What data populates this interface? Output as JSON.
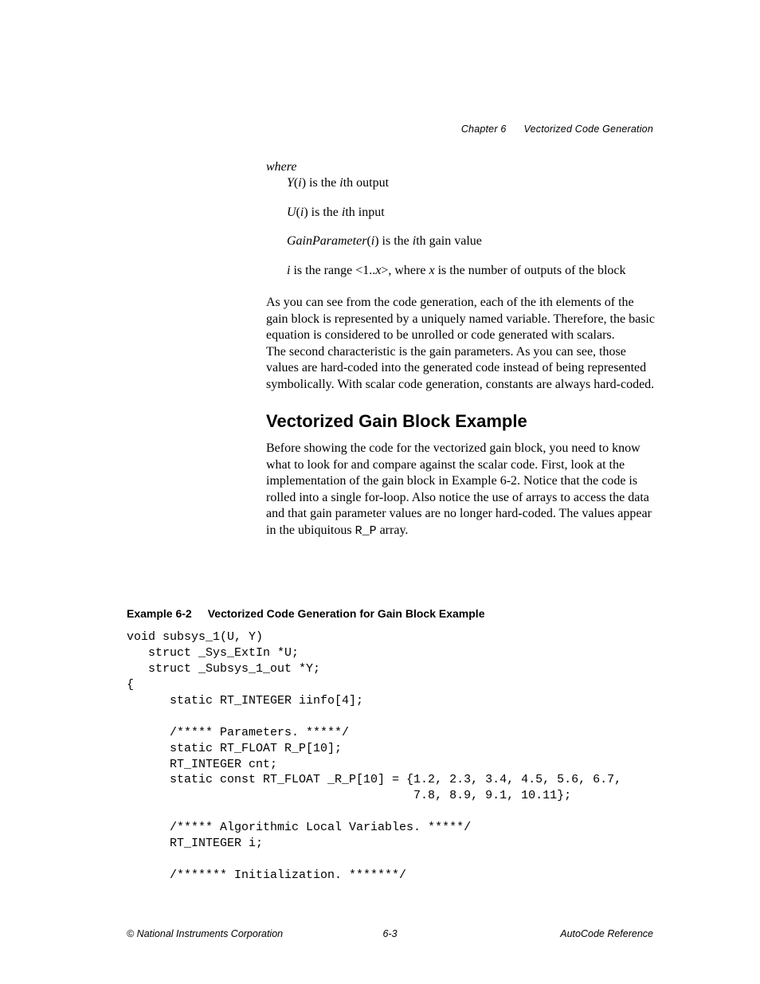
{
  "header": {
    "chapter": "Chapter 6",
    "title": "Vectorized Code Generation"
  },
  "content": {
    "where": "where",
    "def_y_pre": "Y",
    "def_y_arg": "i",
    "def_y_post": ") is the ",
    "def_y_ith": "i",
    "def_y_output": "th output",
    "def_u_pre": "U",
    "def_u_arg": "i",
    "def_u_post": ") is the ",
    "def_u_ith": "i",
    "def_u_input": "th input",
    "def_g_pre": "GainParameter",
    "def_g_arg": "i",
    "def_g_post": ") is the ",
    "def_g_ith": "i",
    "def_g_val": "th gain value",
    "def_i_pre": "i",
    "def_i_mid1": " is the range <1..",
    "def_i_x": "x",
    "def_i_mid2": ">, where ",
    "def_i_x2": "x",
    "def_i_end": " is the number of outputs of the block",
    "para1_a": "As you can see from the code generation, each of the ",
    "para1_i": "i",
    "para1_b": "th elements of the gain block is represented by a uniquely named variable. Therefore, the basic equation is considered to be unrolled or code generated with scalars.",
    "para2": "The second characteristic is the gain parameters. As you can see, those values are hard-coded into the generated code instead of being represented symbolically. With scalar code generation, constants are always hard-coded.",
    "heading": "Vectorized Gain Block Example",
    "para3_a": "Before showing the code for the vectorized gain block, you need to know what to look for and compare against the scalar code. First, look at the implementation of the gain block in Example 6-2. Notice that the code is rolled into a single for-loop. Also notice the use of arrays to access the data and that gain parameter values are no longer hard-coded. The values appear in the ubiquitous ",
    "para3_rp": "R_P",
    "para3_b": " array."
  },
  "example": {
    "label": "Example 6-2",
    "caption": "Vectorized Code Generation for Gain Block Example",
    "code": "void subsys_1(U, Y)\n   struct _Sys_ExtIn *U;\n   struct _Subsys_1_out *Y;\n{\n      static RT_INTEGER iinfo[4];\n\n      /***** Parameters. *****/\n      static RT_FLOAT R_P[10];\n      RT_INTEGER cnt;\n      static const RT_FLOAT _R_P[10] = {1.2, 2.3, 3.4, 4.5, 5.6, 6.7, \n                                        7.8, 8.9, 9.1, 10.11};\n\n      /***** Algorithmic Local Variables. *****/\n      RT_INTEGER i;\n\n      /******* Initialization. *******/"
  },
  "footer": {
    "left": "© National Instruments Corporation",
    "center": "6-3",
    "right": "AutoCode Reference"
  }
}
